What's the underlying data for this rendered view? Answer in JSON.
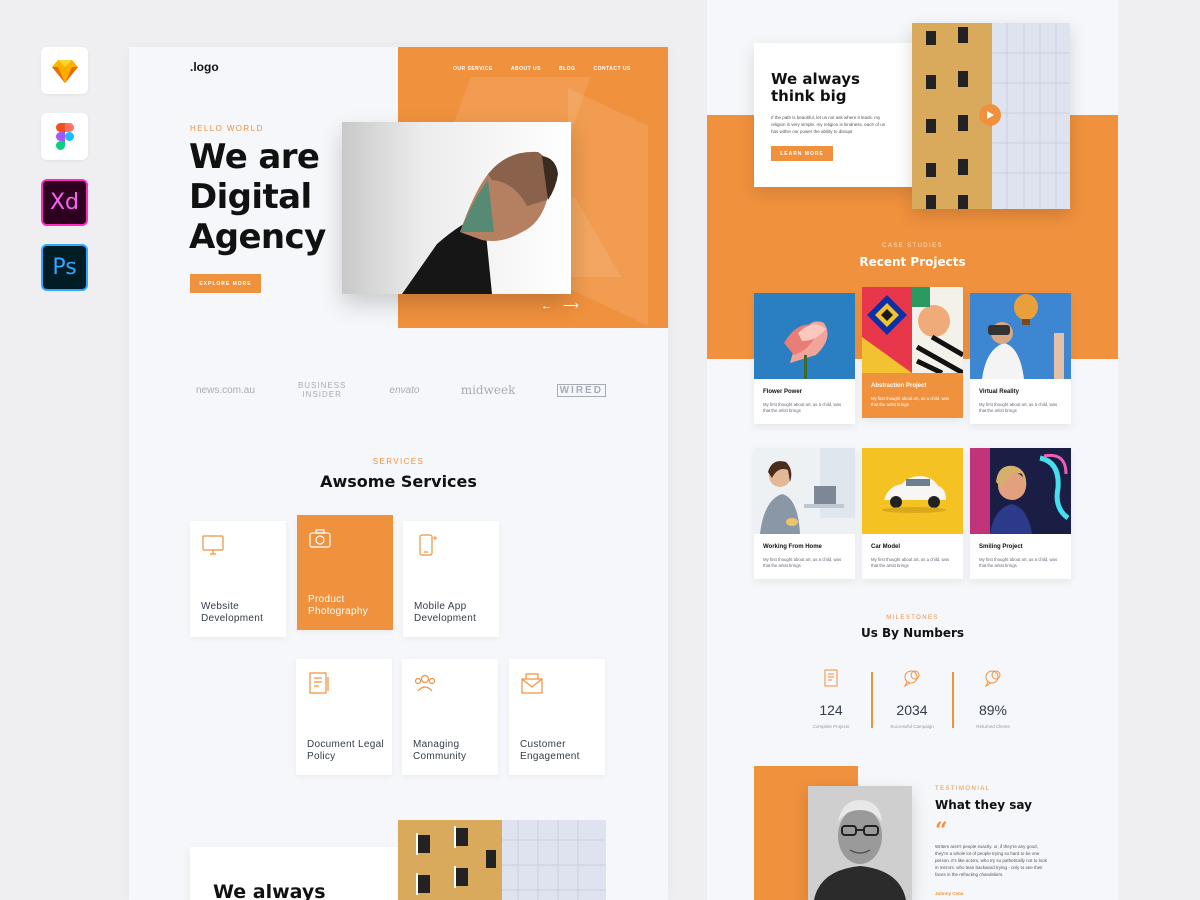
{
  "tools": {
    "sketch": "sketch-icon",
    "figma": "figma-icon",
    "xd": "Xd",
    "ps": "Ps"
  },
  "colors": {
    "accent": "#f0913d",
    "page": "#f5f7fa",
    "canvas": "#efeff1"
  },
  "left": {
    "logo": ".logo",
    "nav": [
      "OUR SERVICE",
      "ABOUT US",
      "BLOG",
      "CONTACT US"
    ],
    "hero": {
      "eyebrow": "HELLO WORLD",
      "title": "We are Digital Agency",
      "button": "EXPLORE MORE",
      "arrows": "←  ⟶"
    },
    "brands": [
      "news.com.au",
      "BUSINESS INSIDER",
      "envato",
      "midweek",
      "WIRED"
    ],
    "services": {
      "eyebrow": "SERVICES",
      "title": "Awsome Services",
      "items": [
        {
          "label": "Website Development",
          "icon": "monitor-icon",
          "active": false
        },
        {
          "label": "Product Photography",
          "icon": "camera-icon",
          "active": true
        },
        {
          "label": "Mobile App Development",
          "icon": "smartphone-icon",
          "active": false
        },
        {
          "label": "Document Legal Policy",
          "icon": "document-icon",
          "active": false
        },
        {
          "label": "Managing Community",
          "icon": "community-icon",
          "active": false
        },
        {
          "label": "Customer Engagement",
          "icon": "envelope-icon",
          "active": false
        }
      ]
    },
    "about": {
      "title": "We always"
    }
  },
  "right": {
    "about": {
      "title": "We always think big",
      "text": "If the path is beautiful, let us not ask where it leads. my religion is very simple. my religion is kindness. each of us has within our power the ability to disrupt",
      "button": "LEARN MORE"
    },
    "case_studies": {
      "eyebrow": "CASE STUDIES",
      "title": "Recent Projects",
      "projects": [
        {
          "title": "Flower Power",
          "text": "My first thought about art, as a child, was that the artist brings",
          "active": false
        },
        {
          "title": "Abstraction Project",
          "text": "My first thought about art, as a child, was that the artist brings",
          "active": true
        },
        {
          "title": "Virtual Reality",
          "text": "My first thought about art, as a child, was that the artist brings",
          "active": false
        },
        {
          "title": "Working From Home",
          "text": "My first thought about art, as a child, was that the artist brings",
          "active": false
        },
        {
          "title": "Car Model",
          "text": "My first thought about art, as a child, was that the artist brings",
          "active": false
        },
        {
          "title": "Smiling Project",
          "text": "My first thought about art, as a child, was that the artist brings",
          "active": false
        }
      ]
    },
    "milestones": {
      "eyebrow": "MILESTONES",
      "title": "Us By Numbers",
      "stats": [
        {
          "value": "124",
          "label": "Complete Projects",
          "icon": "notebook-icon"
        },
        {
          "value": "2034",
          "label": "Successful Campaign",
          "icon": "chat-bubbles-icon"
        },
        {
          "value": "89%",
          "label": "Returned Clients",
          "icon": "chat-bubbles-icon"
        }
      ]
    },
    "testimonial": {
      "eyebrow": "TESTIMONIAL",
      "title": "What they say",
      "quote_mark": "“",
      "text": "Writers aren't people exactly. or, if they're any good, they're a whole lot of people trying so hard to be one person. it's like actors, who try so pathetically not to look in mirrors. who lean backward trying - only to see their faces in the refracting chandeliers.",
      "author": "Johnny Cena"
    }
  }
}
